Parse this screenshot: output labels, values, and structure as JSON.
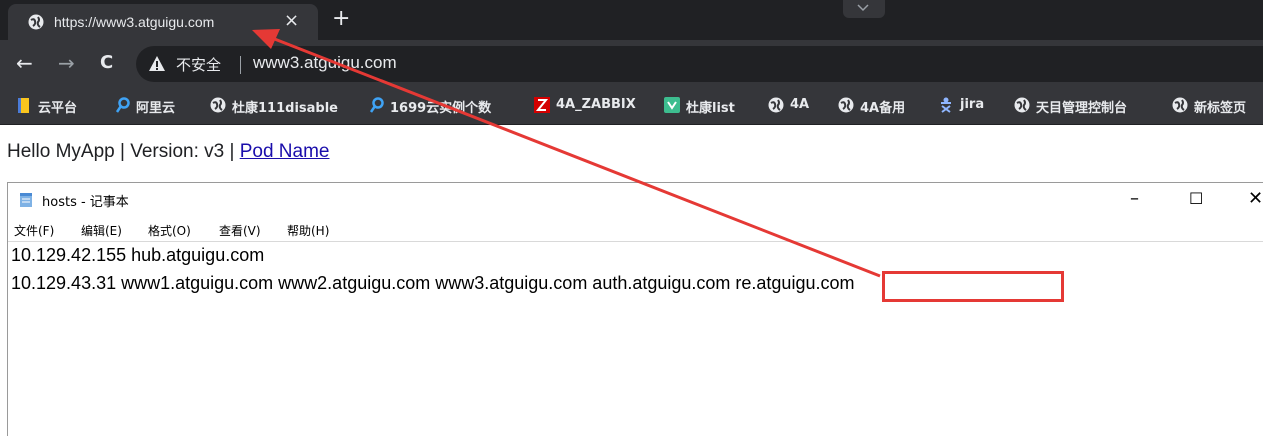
{
  "tab": {
    "title": "https://www3.atguigu.com",
    "close_glyph": "×",
    "newtab_glyph": "+",
    "favicon": "globe-icon"
  },
  "toolbar": {
    "back": "←",
    "forward": "→",
    "reload": "C",
    "security_label": "不安全",
    "url": "www3.atguigu.com"
  },
  "bookmarks": [
    {
      "label": "云平台",
      "icon": "folder-icon"
    },
    {
      "label": "阿里云",
      "icon": "aliyun-icon"
    },
    {
      "label": "杜康111disable",
      "icon": "globe-icon"
    },
    {
      "label": "1699云实例个数",
      "icon": "aliyun-icon"
    },
    {
      "label": "4A_ZABBIX",
      "icon": "zabbix-icon"
    },
    {
      "label": "杜康list",
      "icon": "app-icon"
    },
    {
      "label": "4A",
      "icon": "globe-icon"
    },
    {
      "label": "4A备用",
      "icon": "globe-icon"
    },
    {
      "label": "jira",
      "icon": "jira-icon"
    },
    {
      "label": "天目管理控制台",
      "icon": "globe-icon"
    },
    {
      "label": "新标签页",
      "icon": "globe-icon"
    }
  ],
  "page": {
    "text": "Hello MyApp | Version: v3 | ",
    "link": "Pod Name"
  },
  "notepad": {
    "title": "hosts - 记事本",
    "controls": {
      "minimize": "–",
      "maximize": "☐",
      "close": "✕"
    },
    "menu": [
      "文件(F)",
      "编辑(E)",
      "格式(O)",
      "查看(V)",
      "帮助(H)"
    ],
    "lines": [
      "10.129.42.155 hub.atguigu.com",
      "10.129.43.31 www1.atguigu.com www2.atguigu.com www3.atguigu.com auth.atguigu.com re.atguigu.com"
    ]
  },
  "colors": {
    "annotation": "#e53935",
    "chrome_dark": "#202124",
    "chrome_toolbar": "#35363a",
    "link": "#1a0dab"
  }
}
